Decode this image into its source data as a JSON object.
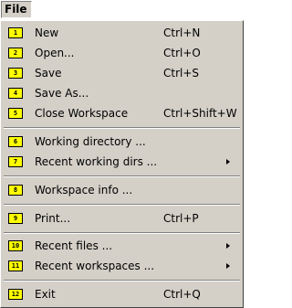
{
  "menubar": {
    "file_label": "File"
  },
  "menu": {
    "items": [
      {
        "num": "1",
        "label": "New",
        "shortcut": "Ctrl+N"
      },
      {
        "num": "2",
        "label": "Open...",
        "shortcut": "Ctrl+O"
      },
      {
        "num": "3",
        "label": "Save",
        "shortcut": "Ctrl+S"
      },
      {
        "num": "4",
        "label": "Save As...",
        "shortcut": ""
      },
      {
        "num": "5",
        "label": "Close Workspace",
        "shortcut": "Ctrl+Shift+W"
      },
      {
        "num": "6",
        "label": "Working directory ...",
        "shortcut": ""
      },
      {
        "num": "7",
        "label": "Recent working dirs ...",
        "shortcut": "",
        "submenu": true
      },
      {
        "num": "8",
        "label": "Workspace info ...",
        "shortcut": ""
      },
      {
        "num": "9",
        "label": "Print...",
        "shortcut": "Ctrl+P"
      },
      {
        "num": "10",
        "label": "Recent files ...",
        "shortcut": "",
        "submenu": true
      },
      {
        "num": "11",
        "label": "Recent workspaces ...",
        "shortcut": "",
        "submenu": true
      },
      {
        "num": "12",
        "label": "Exit",
        "shortcut": "Ctrl+Q"
      }
    ]
  },
  "colors": {
    "menu_background": "#d4d0c8",
    "number_badge": "#ffff00"
  }
}
